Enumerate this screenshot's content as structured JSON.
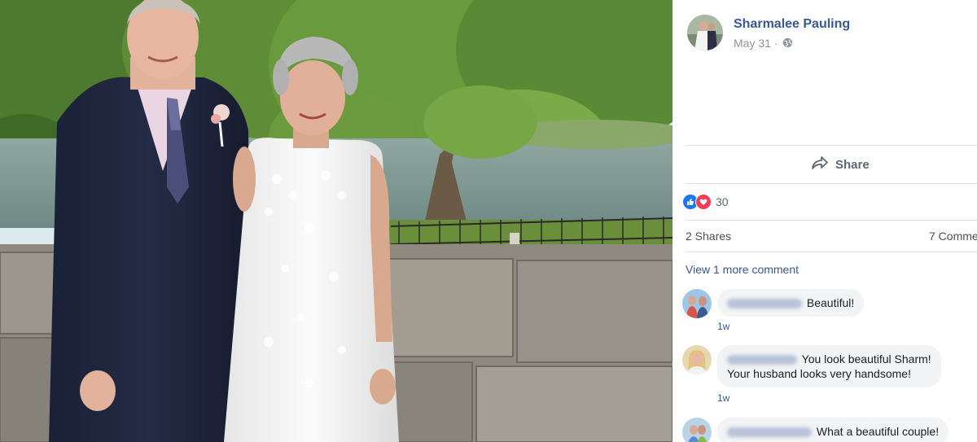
{
  "post": {
    "author": "Sharmalee Pauling",
    "date": "May 31 ·",
    "privacy_icon": "globe-icon"
  },
  "actions": {
    "share_label": "Share",
    "share_icon": "share-arrow-icon"
  },
  "reactions": {
    "count": "30",
    "types": [
      "like-icon",
      "love-icon"
    ]
  },
  "stats": {
    "shares": "2 Shares",
    "comments": "7 Comme"
  },
  "comments_section": {
    "view_more": "View 1 more comment",
    "comments": [
      {
        "text": "Beautiful!",
        "time": "1w"
      },
      {
        "text_line1": "You look beautiful Sharm!",
        "text_line2": "Your husband looks very handsome!",
        "time": "1w"
      },
      {
        "text": "What a beautiful couple!"
      }
    ]
  },
  "colors": {
    "link_blue": "#385898",
    "like_blue": "#1877f2",
    "love_red": "#f33e58",
    "bubble_gray": "#f2f3f5"
  }
}
